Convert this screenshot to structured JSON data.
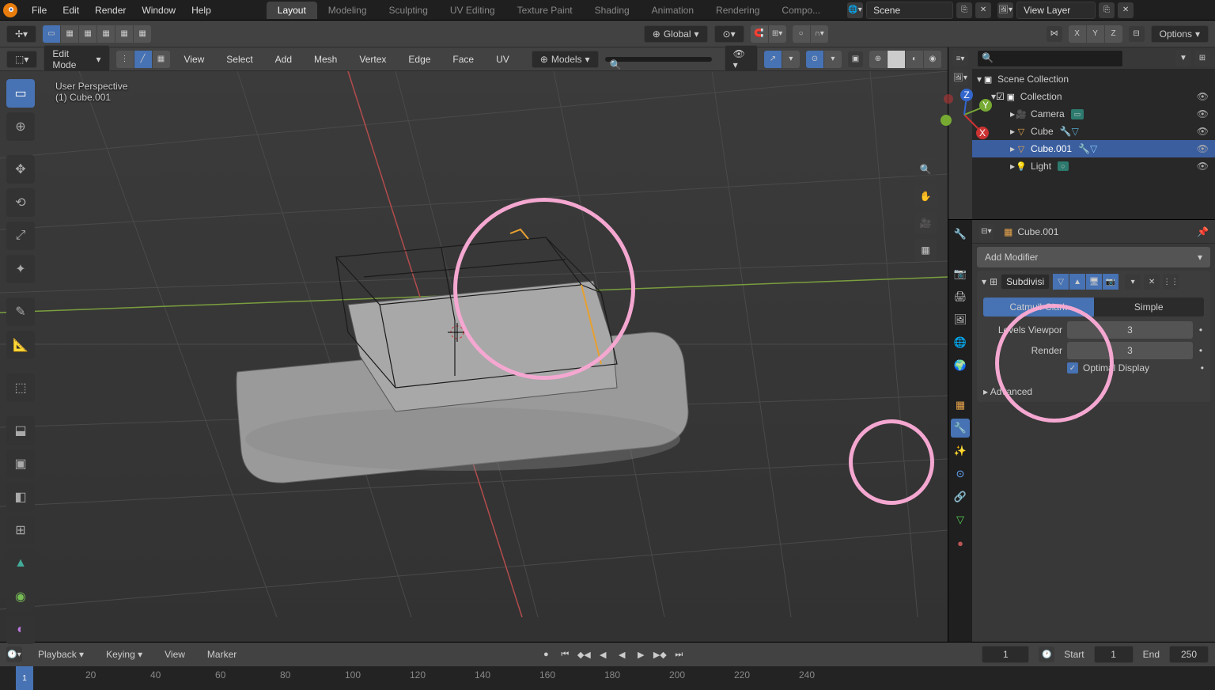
{
  "top_menu": {
    "file": "File",
    "edit": "Edit",
    "render": "Render",
    "window": "Window",
    "help": "Help"
  },
  "workspaces": {
    "layout": "Layout",
    "modeling": "Modeling",
    "sculpting": "Sculpting",
    "uv": "UV Editing",
    "texture": "Texture Paint",
    "shading": "Shading",
    "animation": "Animation",
    "rendering": "Rendering",
    "compositing": "Compo..."
  },
  "scene": {
    "label": "Scene",
    "layer": "View Layer"
  },
  "toolbar": {
    "orientation": "Global",
    "options": "Options"
  },
  "viewport": {
    "mode": "Edit Mode",
    "menus": {
      "view": "View",
      "select": "Select",
      "add": "Add",
      "mesh": "Mesh",
      "vertex": "Vertex",
      "edge": "Edge",
      "face": "Face",
      "uv": "UV"
    },
    "models": "Models",
    "perspective": "User Perspective",
    "object": "(1) Cube.001",
    "axis": {
      "x": "X",
      "y": "Y",
      "z": "Z"
    }
  },
  "outliner": {
    "root": "Scene Collection",
    "collection": "Collection",
    "items": {
      "camera": "Camera",
      "cube": "Cube",
      "cube001": "Cube.001",
      "light": "Light"
    }
  },
  "properties": {
    "context": "Cube.001",
    "add_modifier": "Add Modifier",
    "modifier": {
      "name": "Subdivisi...",
      "catmull": "Catmull-Clark",
      "simple": "Simple",
      "viewport_label": "Levels Viewpor",
      "viewport_value": "3",
      "render_label": "Render",
      "render_value": "3",
      "optimal": "Optimal Display",
      "advanced": "Advanced"
    }
  },
  "timeline": {
    "playback": "Playback",
    "keying": "Keying",
    "view": "View",
    "marker": "Marker",
    "current": "1",
    "start_label": "Start",
    "start": "1",
    "end_label": "End",
    "end": "250",
    "frames": [
      "1",
      "20",
      "40",
      "60",
      "80",
      "100",
      "120",
      "140",
      "160",
      "180",
      "200",
      "220",
      "240"
    ]
  }
}
